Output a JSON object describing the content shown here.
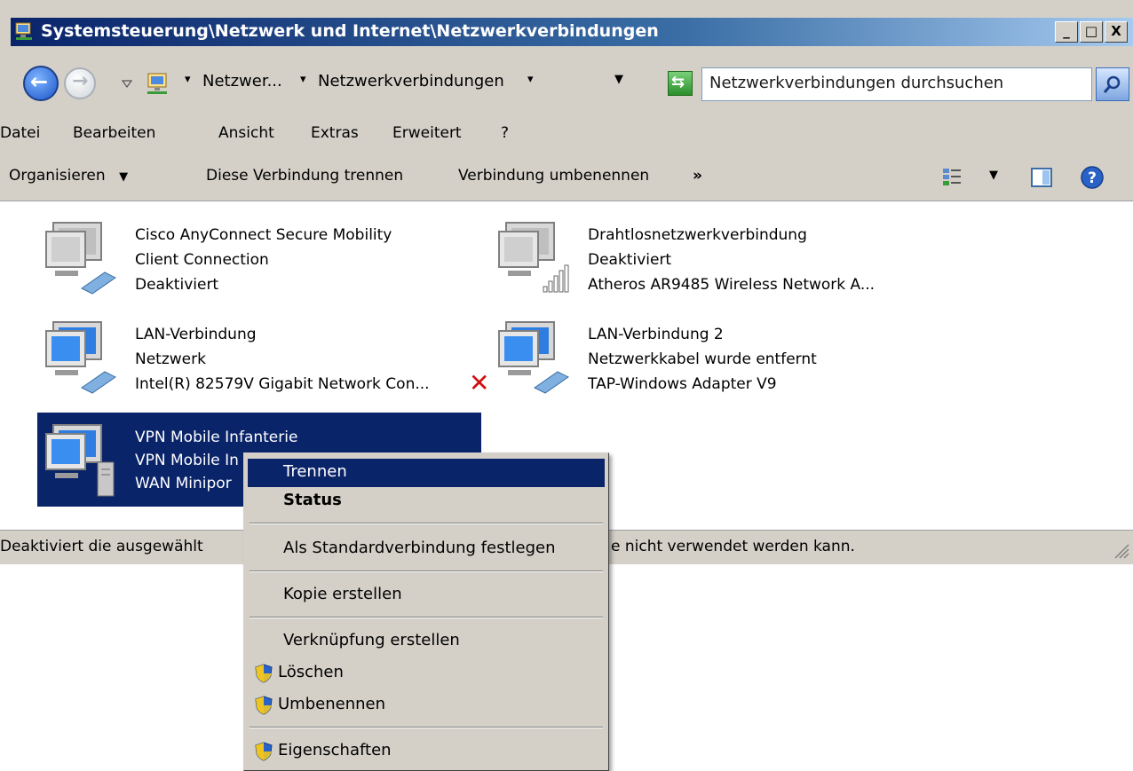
{
  "window": {
    "title": "Systemsteuerung\\Netzwerk und Internet\\Netzwerkverbindungen",
    "controls": {
      "minimize": "_",
      "maximize": "□",
      "close": "X"
    }
  },
  "address_bar": {
    "crumb1": "Netzwer...",
    "crumb2": "Netzwerkverbindungen",
    "search_placeholder": "Netzwerkverbindungen durchsuchen"
  },
  "menubar": [
    "Datei",
    "Bearbeiten",
    "Ansicht",
    "Extras",
    "Erweitert",
    "?"
  ],
  "toolbar": {
    "organize": "Organisieren",
    "disconnect": "Diese Verbindung trennen",
    "rename": "Verbindung umbenennen",
    "more": "»"
  },
  "connections": [
    {
      "name": "Cisco AnyConnect Secure Mobility",
      "line2": "Client Connection",
      "line3": "Deaktiviert",
      "icon": "network-computer-icon"
    },
    {
      "name": "Drahtlosnetzwerkverbindung",
      "line2": "Deaktiviert",
      "line3": "Atheros AR9485 Wireless Network A...",
      "icon": "wireless-computer-icon"
    },
    {
      "name": "LAN-Verbindung",
      "line2": "Netzwerk",
      "line3": "Intel(R) 82579V Gigabit Network Con...",
      "icon": "lan-computer-icon"
    },
    {
      "name": "LAN-Verbindung 2",
      "line2": "Netzwerkkabel wurde entfernt",
      "line3": "TAP-Windows Adapter V9",
      "icon": "lan-disconnected-icon"
    },
    {
      "name": "VPN Mobile Infanterie",
      "line2": "VPN Mobile In",
      "line3": "WAN Minipor",
      "icon": "vpn-computer-icon"
    }
  ],
  "statusbar": {
    "left": "Deaktiviert die ausgewählt",
    "right": "e nicht verwendet werden kann."
  },
  "context_menu": {
    "items": [
      "Trennen",
      "Status",
      "Als Standardverbindung festlegen",
      "Kopie erstellen",
      "Verknüpfung erstellen",
      "Löschen",
      "Umbenennen",
      "Eigenschaften"
    ]
  }
}
